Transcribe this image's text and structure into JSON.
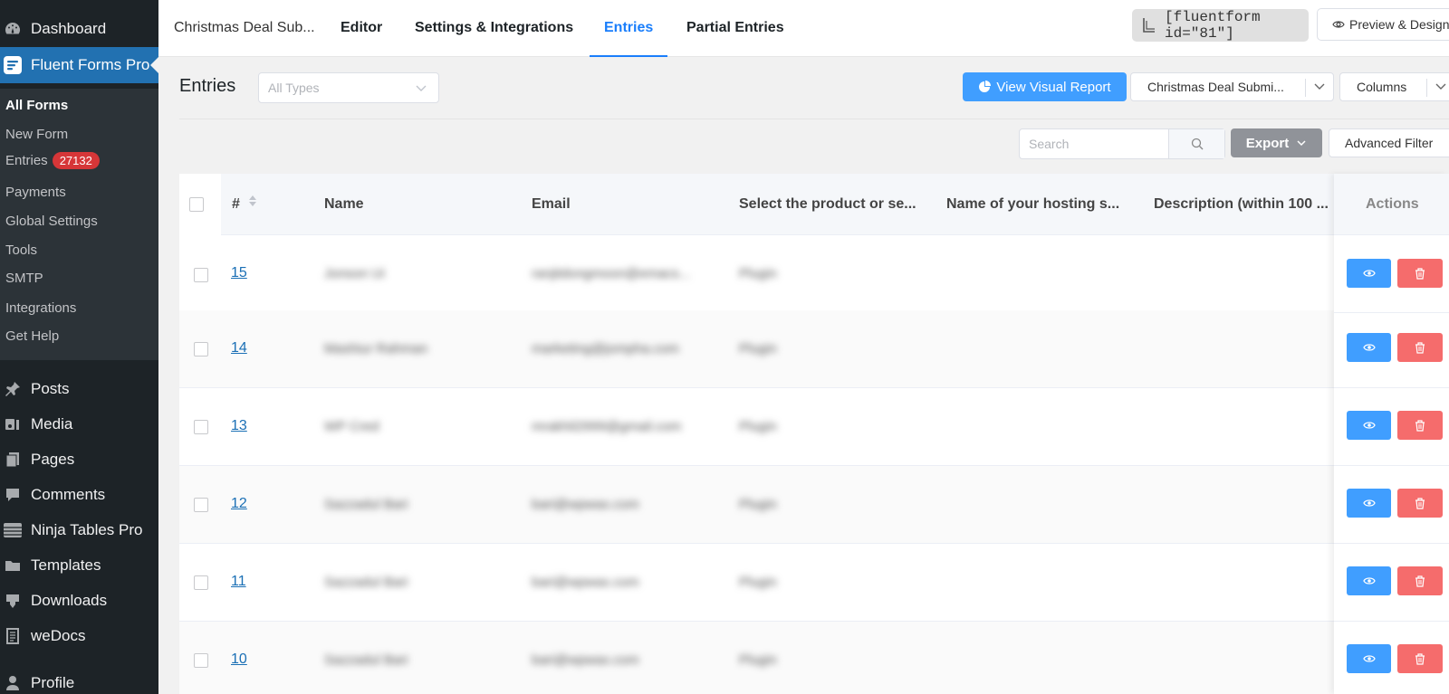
{
  "sidebar": {
    "dashboard": "Dashboard",
    "plugin": "Fluent Forms Pro",
    "submenu": [
      {
        "label": "All Forms"
      },
      {
        "label": "New Form"
      },
      {
        "label": "Entries",
        "badge": "27132"
      },
      {
        "label": "Payments"
      },
      {
        "label": "Global Settings"
      },
      {
        "label": "Tools"
      },
      {
        "label": "SMTP"
      },
      {
        "label": "Integrations"
      },
      {
        "label": "Get Help"
      }
    ],
    "menu": [
      {
        "label": "Posts",
        "icon": "pin-icon"
      },
      {
        "label": "Media",
        "icon": "media-icon"
      },
      {
        "label": "Pages",
        "icon": "pages-icon"
      },
      {
        "label": "Comments",
        "icon": "comment-icon"
      },
      {
        "label": "Ninja Tables Pro",
        "icon": "table-icon"
      },
      {
        "label": "Templates",
        "icon": "folder-icon"
      },
      {
        "label": "Downloads",
        "icon": "download-icon"
      },
      {
        "label": "weDocs",
        "icon": "doc-icon"
      },
      {
        "label": "Profile",
        "icon": "user-icon"
      }
    ]
  },
  "topnav": {
    "form_name": "Christmas Deal Sub...",
    "tabs": [
      "Editor",
      "Settings & Integrations",
      "Entries",
      "Partial Entries"
    ],
    "shortcode": "[fluentform id=\"81\"]",
    "preview": "Preview & Design"
  },
  "toolbar": {
    "title": "Entries",
    "type_placeholder": "All Types",
    "visual_report": "View Visual Report",
    "form_select": "Christmas Deal Submi...",
    "columns": "Columns",
    "search_placeholder": "Search",
    "export": "Export",
    "advanced_filter": "Advanced Filter"
  },
  "table": {
    "headers": {
      "num": "#",
      "name": "Name",
      "email": "Email",
      "product": "Select the product or se...",
      "hosting": "Name of your hosting s...",
      "description": "Description (within 100 ...",
      "actions": "Actions"
    },
    "rows": [
      {
        "id": "15",
        "name": "Jonson Ui",
        "email": "ranjitdongmoon@emacs...",
        "product": "Plugin"
      },
      {
        "id": "14",
        "name": "Mashiur Rahman",
        "email": "marketing@jompha.com",
        "product": "Plugin"
      },
      {
        "id": "13",
        "name": "WP Cred",
        "email": "mrakhil2999@gmail.com",
        "product": "Plugin"
      },
      {
        "id": "12",
        "name": "Sazzadul Bari",
        "email": "bari@wpwax.com",
        "product": "Plugin"
      },
      {
        "id": "11",
        "name": "Sazzadul Bari",
        "email": "bari@wpwax.com",
        "product": "Plugin"
      },
      {
        "id": "10",
        "name": "Sazzadul Bari",
        "email": "bari@wpwax.com",
        "product": "Plugin"
      }
    ]
  },
  "colors": {
    "primary": "#409eff",
    "danger": "#f56c6c",
    "wp_blue": "#2271b1",
    "sidebar": "#1d2327"
  }
}
